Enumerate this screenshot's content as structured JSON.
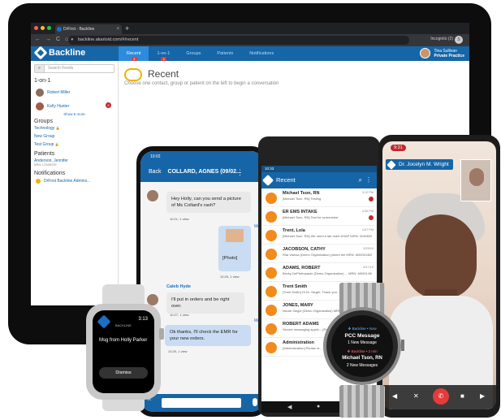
{
  "browser": {
    "tab_title": "DrFirst - Backline",
    "tab_close": "×",
    "new_tab": "+",
    "url": "backline.akarioid.com/#/recent",
    "incognito": "Incognito (2)",
    "incognito_initial": "S",
    "nav": {
      "back": "←",
      "forward": "→",
      "reload": "C",
      "home": "⌂"
    }
  },
  "app": {
    "brand": "Backline",
    "tabs": [
      {
        "label": "Recent",
        "badge": "3"
      },
      {
        "label": "1-on-1",
        "badge": "1"
      },
      {
        "label": "Groups",
        "badge": ""
      },
      {
        "label": "Patients",
        "badge": ""
      },
      {
        "label": "Notifications",
        "badge": ""
      }
    ],
    "user": {
      "name": "Tina Sullivan",
      "org": "Private Practice"
    },
    "colors": {
      "brand": "#1665a7",
      "accent": "#2d8bdc",
      "badge": "#e23b3b",
      "alert": "#c0282d"
    }
  },
  "sidebar": {
    "search_placeholder": "Search Feeds",
    "one_on_one_title": "1-on-1",
    "contacts": [
      {
        "name": "Robert Miller",
        "count": ""
      },
      {
        "name": "Kelly Hunter",
        "count": "6"
      }
    ],
    "show_more": "Show 5 more",
    "groups_title": "Groups",
    "groups": [
      "Technology",
      "New Group",
      "Test Group"
    ],
    "patients_title": "Patients",
    "patient": {
      "name": "Anderson, Jennifer",
      "mrn": "MRN: 123456789"
    },
    "notifications_title": "Notifications",
    "notification": "DrFirst Backline Admins..."
  },
  "main": {
    "title": "Recent",
    "description": "Choose one contact, group or patient on the left to begin a conversation"
  },
  "iphone": {
    "status_time": "10:02",
    "back": "Back",
    "contact": "COLLARD, AGNES (09/02...",
    "messages": [
      {
        "sender": "Caleb Hyde",
        "text": "Hey Holly, can you send a picture of Ms Collard's rash?",
        "meta": "10:21, 1 view"
      },
      {
        "sender": "Me",
        "text": "[Photo]",
        "meta": "10:25, 1 view"
      },
      {
        "sender": "Caleb Hyde",
        "text": "I'll put in orders and be right over.",
        "meta": "10:27, 1 view"
      },
      {
        "sender": "Me",
        "text": "Ok thanks, I'll check the EMR for your new orders.",
        "meta": "10:29, 1 view"
      }
    ]
  },
  "android": {
    "status_time": "10:33",
    "title": "Recent",
    "items": [
      {
        "name": "Michael Tson, RN",
        "preview": "[Michael Tson, RN] Testing",
        "time": "3:12 PM",
        "unread": true
      },
      {
        "name": "ER EMS INTAKE",
        "preview": "[Michael Tson, RN] Test for screenshot",
        "time": "4:39 PM",
        "unread": true
      },
      {
        "name": "Trent, Lola",
        "preview": "[Michael Tson, RN] We need a lab order ASAP MRN: 0246832",
        "time": "4:57 PM",
        "unread": false
      },
      {
        "name": "JACOBSON, CATHY",
        "preview": "Rita Varesa (Demo Organization) joined the MRN: M0000148967 - Account #: V0000012002123",
        "time": "5/29/19",
        "unread": false
      },
      {
        "name": "ADAMS, ROBERT",
        "preview": "Becky DePietropaolo (Demo Organization) ... MRN: M00014967 - Account #: V00081203123",
        "time": "8/17/19",
        "unread": false
      },
      {
        "name": "Trent Smith",
        "preview": "[Trent Smith] Hi Dr. Siegel: Thank you ... (Patient)",
        "time": "",
        "unread": false
      },
      {
        "name": "JONES, MARY",
        "preview": "Nicole Siegel (Demo Organization) MRN: 12345",
        "time": "",
        "unread": false
      },
      {
        "name": "ROBERT ADAMS",
        "preview": "Secure messaging applic... (Patient)",
        "time": "",
        "unread": false
      },
      {
        "name": "Administration",
        "preview": "[Administration] Please re...",
        "time": "",
        "unread": false
      }
    ]
  },
  "video": {
    "time": "9:31",
    "caller": "Dr. Jocelyn M. Wright"
  },
  "apple_watch": {
    "app": "BACKLINE",
    "time": "3:13",
    "message": "Msg from Holly Parker",
    "dismiss": "Dismiss"
  },
  "round_watch": {
    "line1": "❖ Backline • Now",
    "line2": "PCC Message",
    "line3": "1 New Message",
    "line4": "❖ Backline • 2 min",
    "line5": "Michael Tson, RN",
    "line6": "2 New Messages"
  }
}
